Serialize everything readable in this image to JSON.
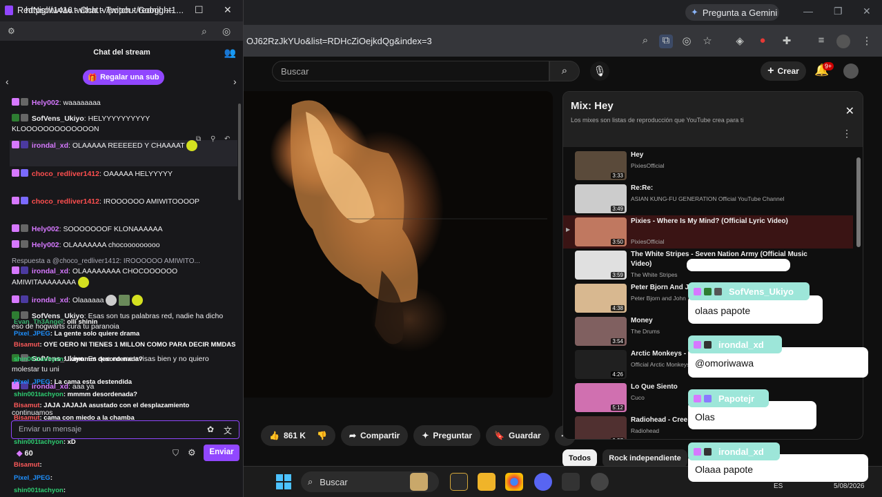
{
  "twitch": {
    "window_title": "RedNight1416 - Chat - Twitch - Googl...",
    "url": "https://www.twitch.tv/popout/rednight1...",
    "header_title": "Chat del stream",
    "gift_label": "Regalar una sub",
    "messages": [
      {
        "user": "Hely002",
        "color": "#d678ff",
        "text": ": waaaaaaaa"
      },
      {
        "user": "SofVens_Ukiyo",
        "color": "#ffffff",
        "text": ": HELYYYYYYYYYY KLOOOOOOOOOOOOON"
      },
      {
        "user": "irondal_xd",
        "color": "#d678ff",
        "text": ": OLAAAAA REEEEED Y CHAAAAT"
      },
      {
        "user": "choco_redliver1412",
        "color": "#ff4f4f",
        "text": ": OAAAAA HELYYYYY"
      },
      {
        "user": "choco_redliver1412",
        "color": "#ff4f4f",
        "text": ": IROOOOOO AMIWITOOOOP"
      },
      {
        "user": "Hely002",
        "color": "#d678ff",
        "text": ": SOOOOOOOF KLONAAAAAA"
      },
      {
        "user": "Hely002",
        "color": "#d678ff",
        "text": ": OLAAAAAAA chocooooooooo"
      },
      {
        "user": "irondal_xd",
        "color": "#d678ff",
        "text": ": OLAAAAAAAA CHOCOOOOOO AMIWITAAAAAAAA"
      },
      {
        "user": "irondal_xd",
        "color": "#d678ff",
        "text": ": Olaaaaaa"
      },
      {
        "user": "SofVens_Ukiyo",
        "color": "#ffffff",
        "text": ": Esas son tus palabras red, nadie ha dicho eso de hogwarts cura tu paranoia"
      },
      {
        "user": "SofVens_Ukiyo",
        "color": "#ffffff",
        "text": ": Es que no me avisas bien y no quiero molestar tu uni"
      },
      {
        "user": "irondal_xd",
        "color": "#d678ff",
        "text": ": aaa ya"
      }
    ],
    "reply_note": "Respuesta a @choco_redliver1412: IROOOOOO AMIWITO...",
    "overlay_lines": [
      {
        "user": "Evan_Th3Angel",
        "text": ": olli shinin"
      },
      {
        "user": "Pixel_JPEG",
        "text": ": La gente solo quiere drama"
      },
      {
        "user": "Bisamut",
        "text": ": OYE OERO NI TIENES 1 MILLON COMO PARA DECIR MMDAS"
      },
      {
        "user": "shin001tachyon",
        "text": ": ...mmmm desordenada?"
      },
      {
        "user": "Pixel_JPEG",
        "text": ": La cama esta destendida"
      },
      {
        "user": "shin001tachyon",
        "text": ": mmmm desordenada?"
      },
      {
        "user": "Bisamut",
        "text": ": JAJA JAJAJA asustado con el desplazamiento"
      },
      {
        "user": "Bisamut",
        "text": ": cama con miedo a la chamba"
      },
      {
        "user": "shin001tachyon",
        "text": ": xD"
      },
      {
        "user": "Bisamut",
        "text": ": "
      },
      {
        "user": "Pixel_JPEG",
        "text": ": "
      },
      {
        "user": "shin001tachyon",
        "text": ": "
      }
    ],
    "partial_continuamos": "continuamos",
    "input_placeholder": "Enviar un mensaje",
    "points": "60",
    "send_label": "Enviar"
  },
  "chrome": {
    "gemini_label": "Pregunta a Gemini",
    "url": "OJ62RzJkYUo&list=RDHcZiOejkdQg&index=3"
  },
  "youtube": {
    "search_placeholder": "Buscar",
    "create_label": "Crear",
    "notif_badge": "9+",
    "likes": "861 K",
    "share_label": "Compartir",
    "ask_label": "Preguntar",
    "save_label": "Guardar",
    "chips": [
      "Todos",
      "Rock independiente",
      "R"
    ],
    "mix": {
      "title": "Mix: Hey",
      "subtitle": "Los mixes son listas de reproducción que YouTube crea para ti",
      "items": [
        {
          "title": "Hey",
          "channel": "PixiesOfficial",
          "duration": "3:33",
          "thumb": "#5a4a3a"
        },
        {
          "title": "Re:Re:",
          "channel": "ASIAN KUNG-FU GENERATION Official YouTube Channel",
          "duration": "3:49",
          "thumb": "#cccccc"
        },
        {
          "title": "Pixies - Where Is My Mind? (Official Lyric Video)",
          "channel": "PixiesOfficial",
          "duration": "3:50",
          "thumb": "#c07860",
          "current": true
        },
        {
          "title": "The White Stripes - Seven Nation Army (Official Music Video)",
          "channel": "The White Stripes",
          "duration": "3:59",
          "thumb": "#e0e0e0"
        },
        {
          "title": "Peter Bjorn And J",
          "channel": "Peter Bjorn and John",
          "duration": "4:38",
          "thumb": "#d8b890"
        },
        {
          "title": "Money",
          "channel": "The Drums",
          "duration": "3:54",
          "thumb": "#806060"
        },
        {
          "title": "Arctic Monkeys -",
          "channel": "Official Arctic Monkeys",
          "duration": "4:26",
          "thumb": "#202020"
        },
        {
          "title": "Lo Que Siento",
          "channel": "Cuco",
          "duration": "5:12",
          "thumb": "#d070b0"
        },
        {
          "title": "Radiohead - Cree",
          "channel": "Radiohead",
          "duration": "3:57",
          "thumb": "#503030"
        }
      ]
    }
  },
  "overlay": {
    "bubbles": [
      {
        "user": "SofVens_Ukiyo",
        "message": "olaas papote"
      },
      {
        "user": "irondal_xd",
        "message": "@omoriwawa"
      },
      {
        "user": "Papotejr",
        "message": "Olas"
      },
      {
        "user": "irondal_xd",
        "message": "Olaaa papote"
      }
    ]
  },
  "taskbar": {
    "search_label": "Buscar",
    "lang": "ES",
    "date": "5/08/2026"
  }
}
